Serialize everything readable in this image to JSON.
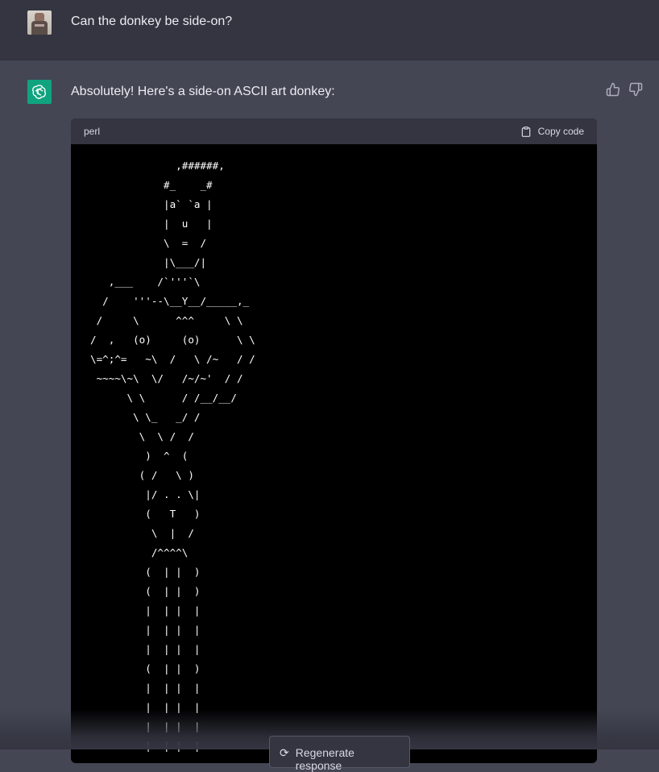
{
  "user_message": {
    "text": "Can the donkey be side-on?"
  },
  "assistant_message": {
    "text": "Absolutely! Here's a side-on ASCII art donkey:",
    "code_block": {
      "language": "perl",
      "copy_label": "Copy code",
      "lines": [
        "              ,######,",
        "            #_    _#",
        "            |a` `a |",
        "            |  u   |",
        "            \\  =  /",
        "            |\\___/|",
        "   ,___    /`'''`\\",
        "  /    '''--\\__Y__/_____,_",
        " /     \\      ^^^     \\ \\",
        "/  ,   (o)     (o)      \\ \\",
        "\\=^;^=   ~\\  /   \\ /~   / /",
        " ~~~~\\~\\  \\/   /~/~'  / /",
        "      \\ \\      / /__/__/",
        "       \\ \\_   _/ /",
        "        \\  \\ /  /",
        "         )  ^  (",
        "        ( /   \\ )",
        "         |/ . . \\|",
        "         (   T   )",
        "          \\  |  /",
        "          /^^^^\\",
        "         (  | |  )",
        "         (  | |  )",
        "         |  | |  |",
        "         |  | |  |",
        "         |  | |  |",
        "         (  | |  )",
        "         |  | |  |",
        "         |  | |  |",
        "         |  | |  |",
        "         |  | |  |"
      ]
    }
  },
  "regenerate_label": "Regenerate response",
  "colors": {
    "page_bg": "#444654",
    "user_row_bg": "#343541",
    "code_bg": "#000000",
    "accent_green": "#10a37f"
  }
}
